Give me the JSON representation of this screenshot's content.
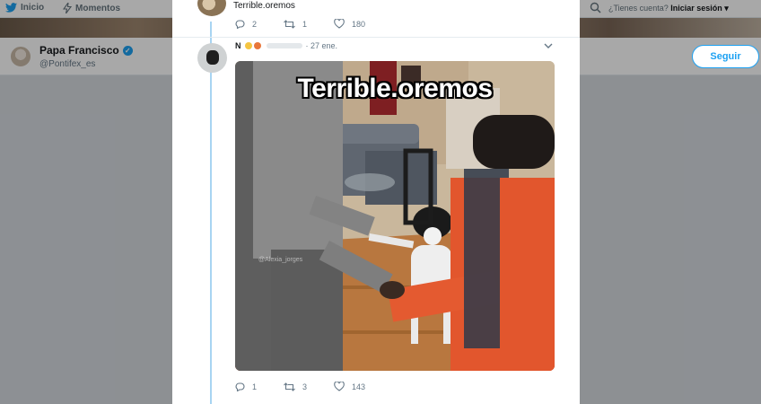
{
  "nav": {
    "home_label": "Inicio",
    "moments_label": "Momentos",
    "account_prompt": "¿Tienes cuenta?",
    "login_label": "Iniciar sesión ▾"
  },
  "profile": {
    "name": "Papa Francisco",
    "handle": "@Pontifex_es",
    "follow_label": "Seguir"
  },
  "tweet_top": {
    "text": "Terrible.oremos",
    "replies": "2",
    "retweets": "1",
    "likes": "180"
  },
  "tweet_main": {
    "date": "· 27 ene.",
    "image_caption": "Terrible.oremos",
    "watermark": "@Alexia_jorges",
    "replies": "1",
    "retweets": "3",
    "likes": "143"
  },
  "colors": {
    "accent": "#1da1f2",
    "thread_line": "#a8d4f2",
    "muted": "#657786"
  }
}
